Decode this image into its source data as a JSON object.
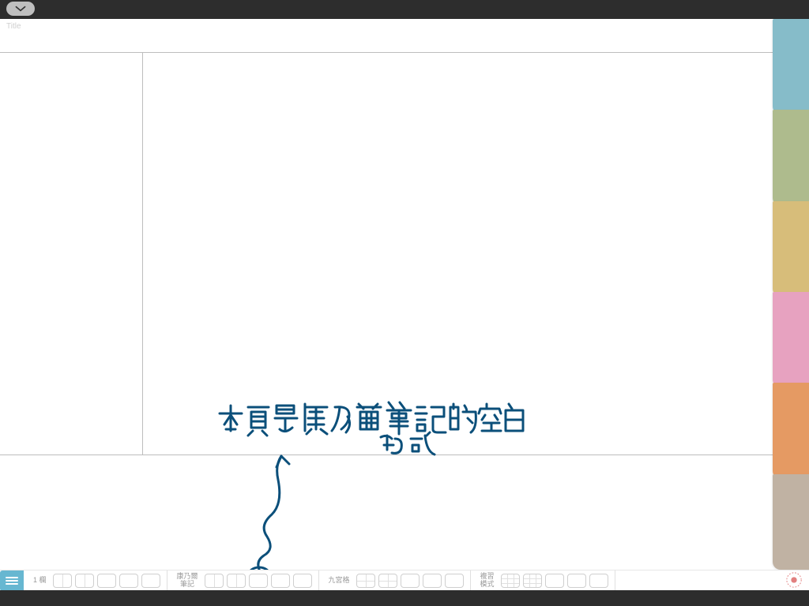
{
  "topbar": {
    "title_placeholder": "Title"
  },
  "handwriting_text": "本頁是康乃爾筆記的空白格式",
  "tabs": [
    {
      "color": "#86bcc9"
    },
    {
      "color": "#aebb8d"
    },
    {
      "color": "#d7bd7a"
    },
    {
      "color": "#e7a2c0"
    },
    {
      "color": "#e59a63"
    },
    {
      "color": "#c0b2a3"
    }
  ],
  "toolbar": {
    "section1_label": "1 欄",
    "section2_label": "康乃爾\n筆記",
    "section3_label": "九宮格",
    "section4_label": "複習\n模式"
  }
}
